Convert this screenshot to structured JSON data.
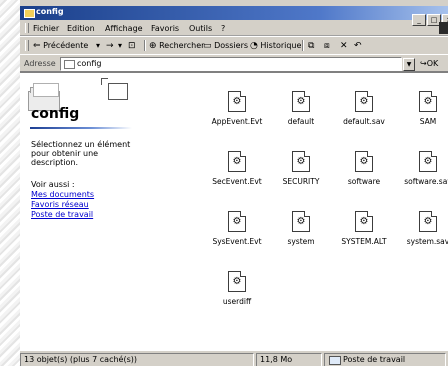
{
  "window": {
    "title": "config",
    "controls": [
      "_",
      "□",
      "×"
    ]
  },
  "menu": {
    "items": [
      "Fichier",
      "Edition",
      "Affichage",
      "Favoris",
      "Outils",
      "?"
    ]
  },
  "toolbar": {
    "back": "Précédente",
    "search": "Rechercher",
    "folders": "Dossiers",
    "history": "Historique"
  },
  "address": {
    "label": "Adresse",
    "value": "config",
    "go": "OK"
  },
  "sidebar": {
    "title": "config",
    "description": "Sélectionnez un élément pour obtenir une description.",
    "see_also": "Voir aussi :",
    "links": [
      "Mes documents",
      "Favoris réseau",
      "Poste de travail"
    ]
  },
  "files": [
    {
      "name": "AppEvent.Evt"
    },
    {
      "name": "default"
    },
    {
      "name": "default.sav"
    },
    {
      "name": "SAM"
    },
    {
      "name": "SecEvent.Evt"
    },
    {
      "name": "SECURITY"
    },
    {
      "name": "software"
    },
    {
      "name": "software.sav"
    },
    {
      "name": "SysEvent.Evt"
    },
    {
      "name": "system"
    },
    {
      "name": "SYSTEM.ALT"
    },
    {
      "name": "system.sav"
    },
    {
      "name": "userdiff"
    }
  ],
  "status": {
    "objects": "13 objet(s) (plus 7 caché(s))",
    "size": "11,8 Mo",
    "zone": "Poste de travail"
  },
  "colors": {
    "title_bar": "#1a3f8a",
    "link": "#0000cc",
    "chrome": "#d4d0c8"
  }
}
